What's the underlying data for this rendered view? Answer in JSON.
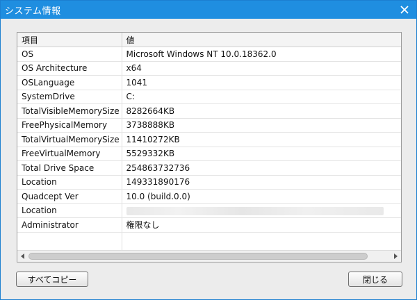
{
  "window": {
    "title": "システム情報"
  },
  "table": {
    "headers": [
      "項目",
      "値"
    ],
    "rows": [
      {
        "key": "OS",
        "value": "Microsoft Windows NT 10.0.18362.0"
      },
      {
        "key": "OS Architecture",
        "value": "x64"
      },
      {
        "key": "OSLanguage",
        "value": "1041"
      },
      {
        "key": "SystemDrive",
        "value": "C:"
      },
      {
        "key": "TotalVisibleMemorySize",
        "value": "8282664KB"
      },
      {
        "key": "FreePhysicalMemory",
        "value": "3738888KB"
      },
      {
        "key": "TotalVirtualMemorySize",
        "value": "11410272KB"
      },
      {
        "key": "FreeVirtualMemory",
        "value": "5529332KB"
      },
      {
        "key": "Total Drive Space",
        "value": "254863732736"
      },
      {
        "key": "Location",
        "value": "149331890176"
      },
      {
        "key": "Quadcept Ver",
        "value": "10.0 (build.0.0)"
      },
      {
        "key": "Location",
        "value": ""
      },
      {
        "key": "Administrator",
        "value": "権限なし"
      }
    ]
  },
  "buttons": {
    "copy_all": "すべてコピー",
    "close": "閉じる"
  }
}
